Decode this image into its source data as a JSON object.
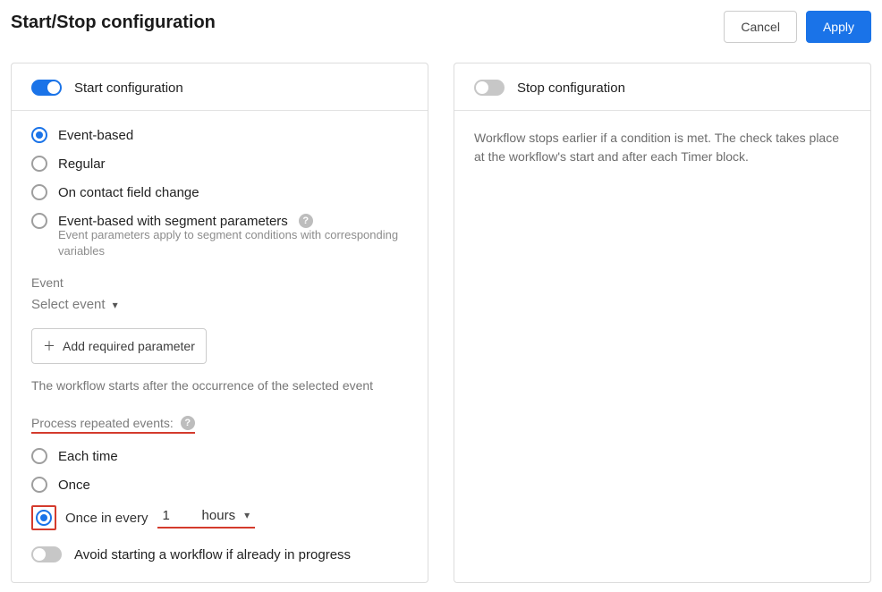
{
  "header": {
    "title": "Start/Stop configuration",
    "cancel": "Cancel",
    "apply": "Apply"
  },
  "startPanel": {
    "toggleLabel": "Start configuration",
    "options": {
      "eventBased": "Event-based",
      "regular": "Regular",
      "onFieldChange": "On contact field change",
      "eventSegment": "Event-based with segment parameters",
      "eventSegmentHelp": "Event parameters apply to segment conditions with corresponding variables"
    },
    "eventLabel": "Event",
    "eventSelectPlaceholder": "Select event",
    "addParamLabel": "Add required parameter",
    "startInfo": "The workflow starts after the occurrence of the selected event",
    "repeatLabel": "Process repeated events:",
    "repeat": {
      "eachTime": "Each time",
      "once": "Once",
      "onceEveryPrefix": "Once in every",
      "onceEveryValue": "1",
      "onceEveryUnit": "hours"
    },
    "avoidLabel": "Avoid starting a workflow if already in progress"
  },
  "stopPanel": {
    "toggleLabel": "Stop configuration",
    "description": "Workflow stops earlier if a condition is met. The check takes place at the workflow's start and after each Timer block."
  }
}
